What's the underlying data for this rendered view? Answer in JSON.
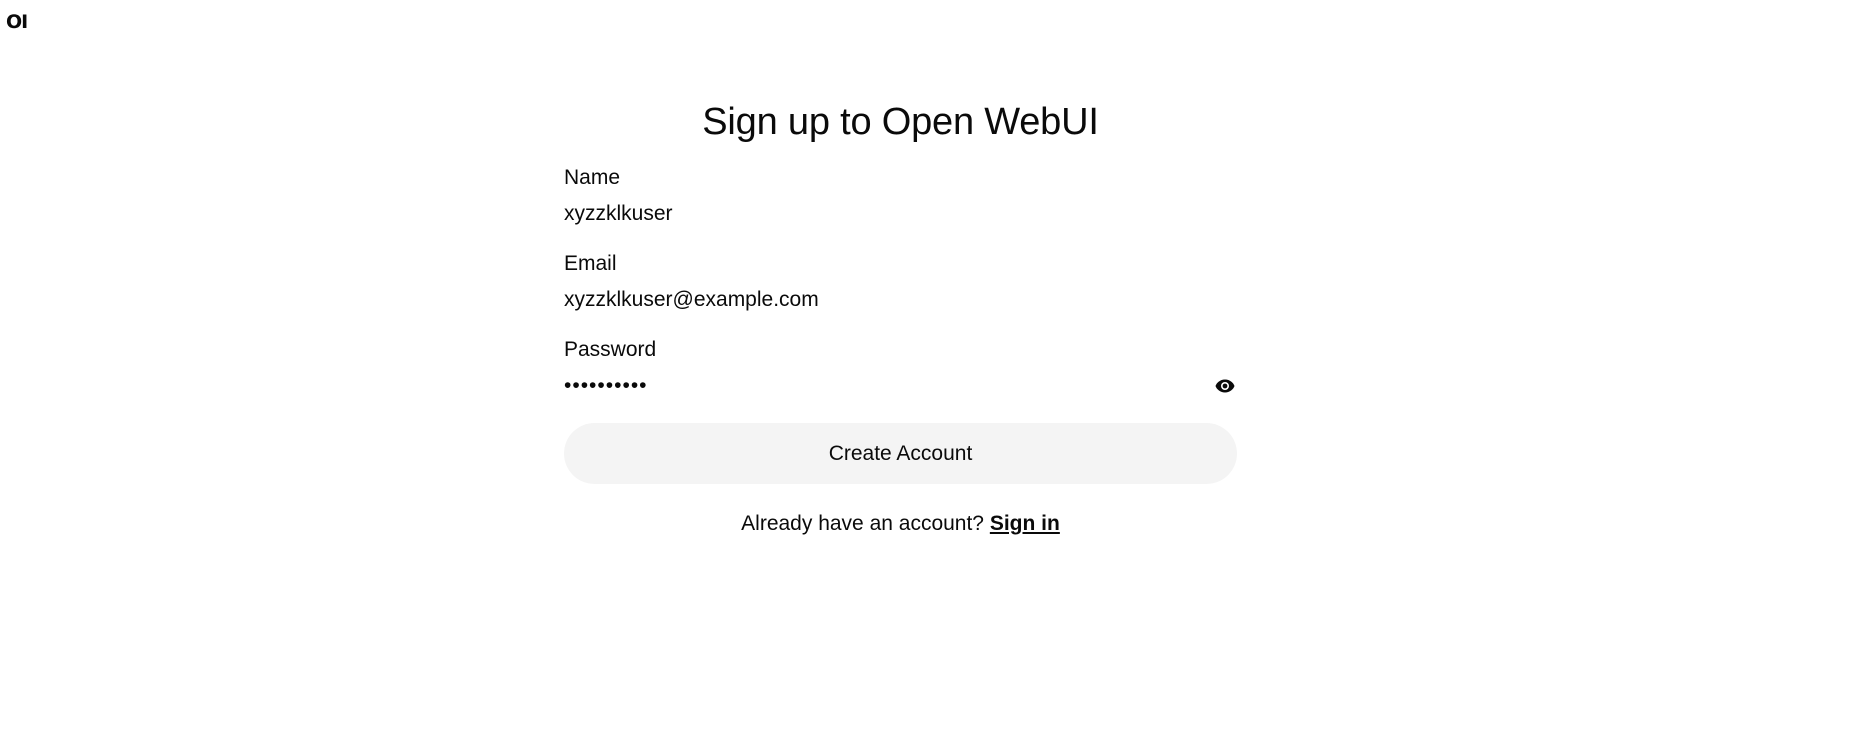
{
  "brand": {
    "logo_text": "OI"
  },
  "page": {
    "title": "Sign up to Open WebUI"
  },
  "form": {
    "name": {
      "label": "Name",
      "value": "xyzzklkuser"
    },
    "email": {
      "label": "Email",
      "value": "xyzzklkuser@example.com"
    },
    "password": {
      "label": "Password",
      "value": "••••••••••",
      "toggle_icon": "eye-icon"
    },
    "submit_label": "Create Account"
  },
  "footer": {
    "prompt": "Already have an account?",
    "link_label": "Sign in"
  }
}
